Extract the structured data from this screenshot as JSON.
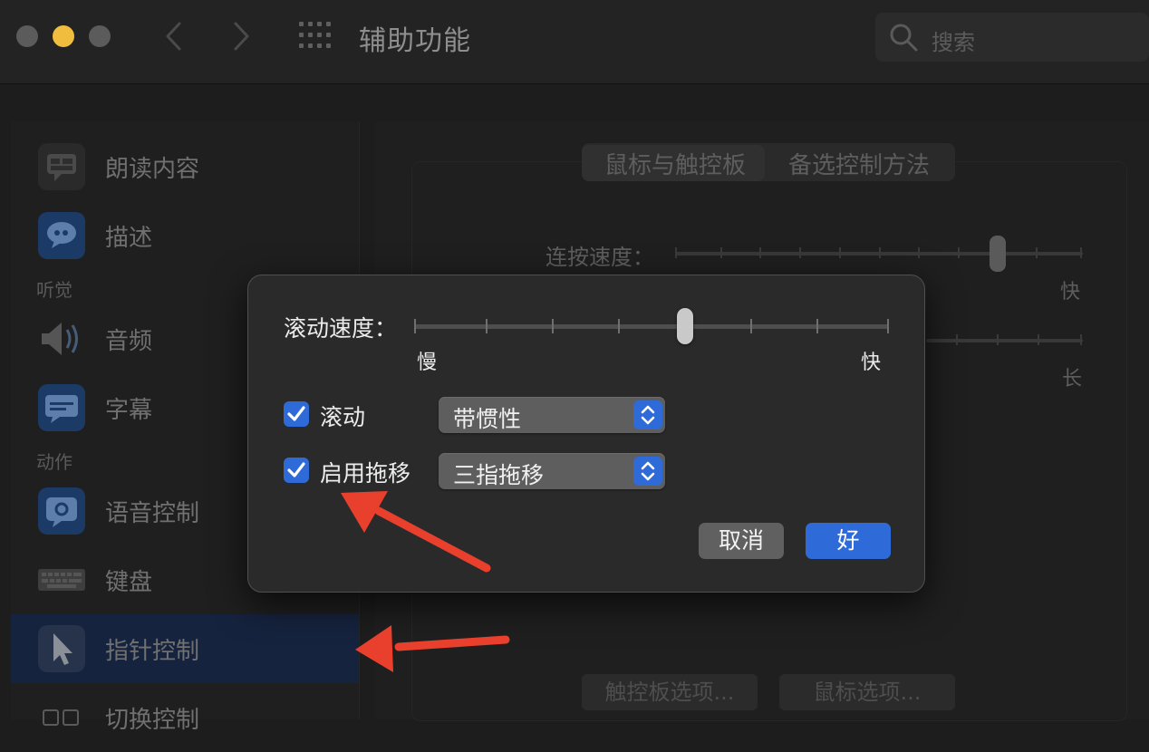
{
  "window": {
    "title": "辅助功能"
  },
  "search": {
    "placeholder": "搜索"
  },
  "sidebar": {
    "items": [
      {
        "label": "朗读内容",
        "icon": "speech-bubble-icon"
      },
      {
        "label": "描述",
        "icon": "quote-bubble-icon"
      },
      {
        "label": "音频",
        "icon": "speaker-icon"
      },
      {
        "label": "字幕",
        "icon": "captions-icon"
      },
      {
        "label": "语音控制",
        "icon": "voice-control-icon"
      },
      {
        "label": "键盘",
        "icon": "keyboard-icon"
      },
      {
        "label": "指针控制",
        "icon": "pointer-icon",
        "selected": true
      },
      {
        "label": "切换控制",
        "icon": "switch-control-icon"
      }
    ],
    "sections": {
      "hearing": "听觉",
      "motor": "动作"
    }
  },
  "pane": {
    "tabs": [
      {
        "label": "鼠标与触控板",
        "selected": true
      },
      {
        "label": "备选控制方法"
      }
    ],
    "double_click_speed_label": "连按速度：",
    "fast_label": "快",
    "long_label": "长",
    "trackpad_options_button": "触控板选项...",
    "mouse_options_button": "鼠标选项..."
  },
  "dialog": {
    "scroll_speed_label": "滚动速度：",
    "scroll_speed_slow": "慢",
    "scroll_speed_fast": "快",
    "scroll_speed_level": 0.571,
    "scroll_checkbox_label": "滚动",
    "scroll_checked": true,
    "scroll_mode_value": "带惯性",
    "drag_checkbox_label": "启用拖移",
    "drag_checked": true,
    "drag_mode_value": "三指拖移",
    "cancel_label": "取消",
    "ok_label": "好"
  },
  "colors": {
    "accent": "#2f6bd8",
    "annotation_arrow": "#e8402c",
    "traffic_minimize": "#f0bd3f"
  }
}
